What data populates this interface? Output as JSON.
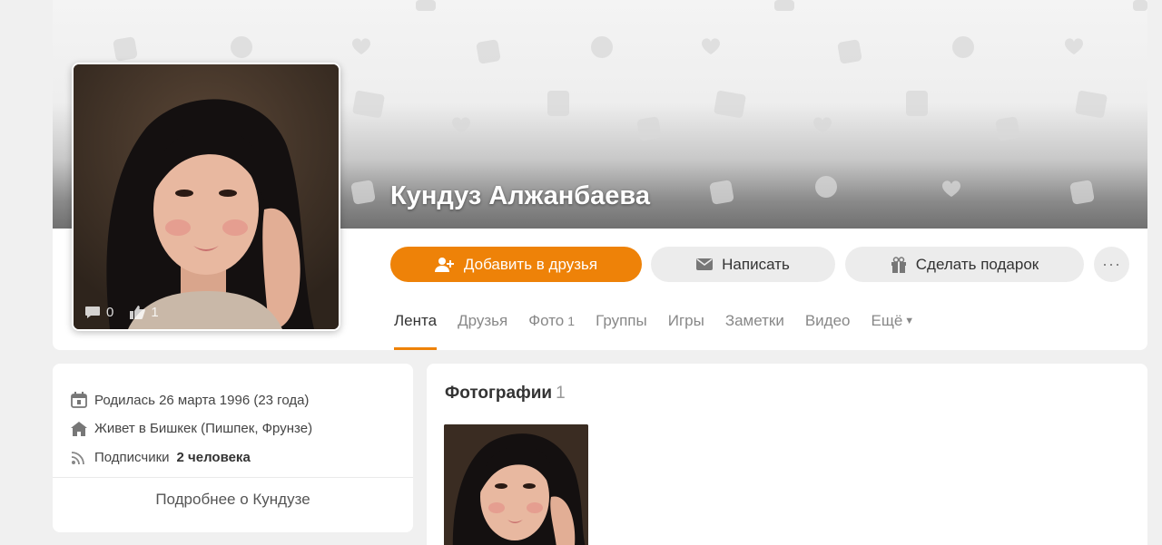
{
  "profile": {
    "name": "Кундуз Алжанбаева",
    "avatar_comments": "0",
    "avatar_likes": "1"
  },
  "actions": {
    "add_friend": "Добавить в друзья",
    "message": "Написать",
    "gift": "Сделать подарок",
    "more": "···"
  },
  "tabs": [
    {
      "label": "Лента",
      "active": true
    },
    {
      "label": "Друзья"
    },
    {
      "label": "Фото",
      "count": "1"
    },
    {
      "label": "Группы"
    },
    {
      "label": "Игры"
    },
    {
      "label": "Заметки"
    },
    {
      "label": "Видео"
    },
    {
      "label": "Ещё"
    }
  ],
  "info": {
    "birth": "Родилась 26 марта 1996 (23 года)",
    "lives": "Живет в Бишкек (Пишпек, Фрунзе)",
    "subscribers_prefix": "Подписчики",
    "subscribers_count": "2 человека",
    "more_link": "Подробнее о Кундузе"
  },
  "photos": {
    "title": "Фотографии",
    "count": "1"
  },
  "colors": {
    "accent": "#ee8208",
    "button_gray": "#ececec",
    "page_bg": "#f0f0f0"
  }
}
